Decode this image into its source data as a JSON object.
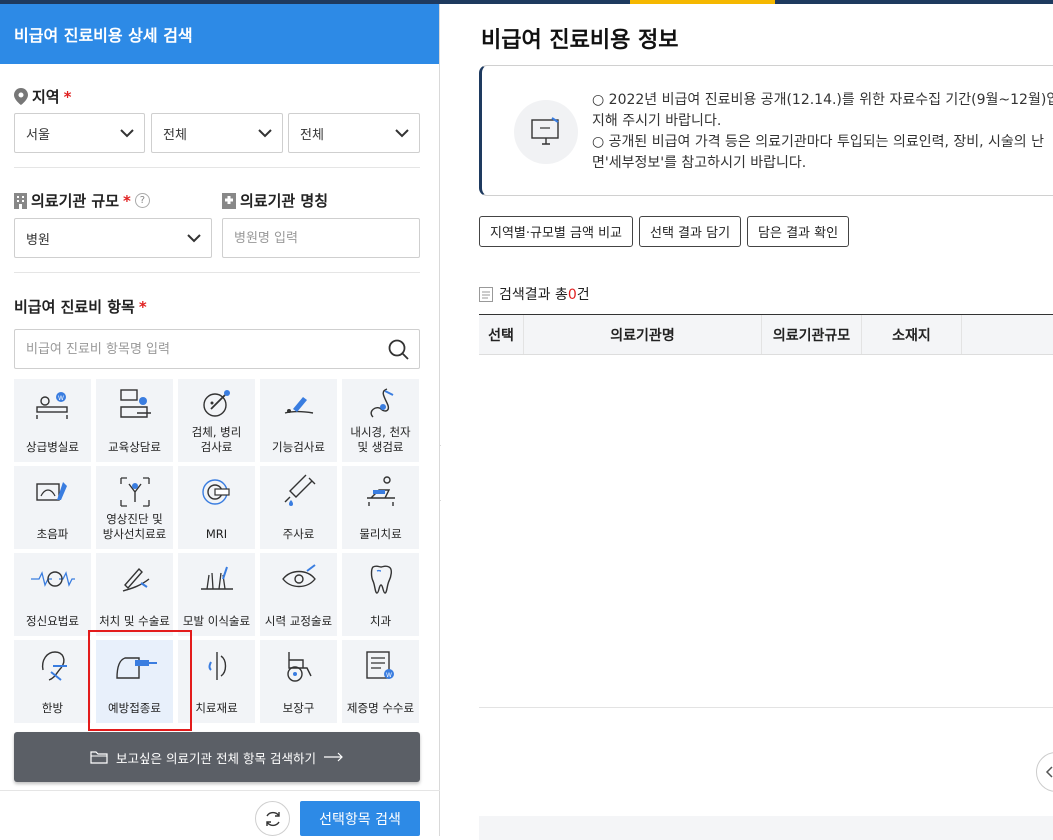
{
  "left_panel": {
    "title": "비급여 진료비용 상세 검색",
    "region": {
      "label": "지역",
      "required_mark": "*",
      "selects": [
        "서울",
        "전체",
        "전체"
      ]
    },
    "hospital_size": {
      "label": "의료기관 규모",
      "required_mark": "*",
      "help": "?",
      "value": "병원"
    },
    "hospital_name": {
      "label": "의료기관 명칭",
      "placeholder": "병원명 입력"
    },
    "items": {
      "label": "비급여 진료비 항목",
      "required_mark": "*",
      "search_placeholder": "비급여 진료비 항목명 입력",
      "tiles": [
        {
          "label": "상급병실료",
          "icon": "hospital-bed-icon"
        },
        {
          "label": "교육상담료",
          "icon": "consultation-icon"
        },
        {
          "label": "검체, 병리\n검사료",
          "icon": "microscope-sample-icon"
        },
        {
          "label": "기능검사료",
          "icon": "function-test-icon"
        },
        {
          "label": "내시경, 천자\n및 생검료",
          "icon": "endoscope-icon"
        },
        {
          "label": "초음파",
          "icon": "ultrasound-icon"
        },
        {
          "label": "영상진단 및\n방사선치료료",
          "icon": "radiology-icon"
        },
        {
          "label": "MRI",
          "icon": "mri-icon"
        },
        {
          "label": "주사료",
          "icon": "syringe-icon"
        },
        {
          "label": "물리치료",
          "icon": "physical-therapy-icon"
        },
        {
          "label": "정신요법료",
          "icon": "brain-wave-icon"
        },
        {
          "label": "처치 및 수술료",
          "icon": "surgery-icon"
        },
        {
          "label": "모발 이식술료",
          "icon": "hair-transplant-icon"
        },
        {
          "label": "시력 교정술료",
          "icon": "eye-correction-icon"
        },
        {
          "label": "치과",
          "icon": "tooth-icon"
        },
        {
          "label": "한방",
          "icon": "acupuncture-ear-icon"
        },
        {
          "label": "예방접종료",
          "icon": "vaccination-icon"
        },
        {
          "label": "치료재료",
          "icon": "treatment-material-icon"
        },
        {
          "label": "보장구",
          "icon": "wheelchair-icon"
        },
        {
          "label": "제증명 수수료",
          "icon": "certificate-icon"
        }
      ]
    },
    "search_all_label": "보고싶은 의료기관 전체 항목 검색하기",
    "submit_label": "선택항목 검색"
  },
  "right_panel": {
    "title": "비급여 진료비용 정보",
    "notice_lines": [
      "○ 2022년 비급여 진료비용 공개(12.14.)를 위한 자료수집 기간(9월~12월)입",
      "지해 주시기 바랍니다.",
      "○ 공개된 비급여 가격 등은 의료기관마다 투입되는 의료인력, 장비, 시술의 난",
      "면'세부정보'를 참고하시기 바랍니다."
    ],
    "buttons": [
      "지역별·규모별 금액 비교",
      "선택 결과 담기",
      "담은 결과 확인"
    ],
    "result_prefix": "검색결과 총",
    "result_count": "0",
    "result_suffix": "건",
    "columns": [
      "선택",
      "의료기관명",
      "의료기관규모",
      "소재지"
    ]
  },
  "colors": {
    "primary_blue": "#2d8ae6",
    "navy": "#1e3a5f",
    "accent_yellow": "#f5b800",
    "required_red": "#e02020",
    "highlight_red": "#e31b1b"
  }
}
